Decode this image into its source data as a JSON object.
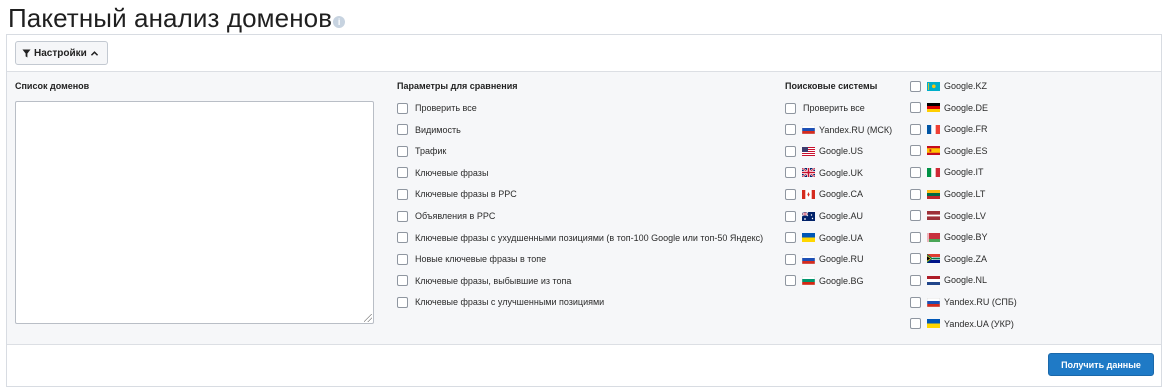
{
  "page": {
    "title": "Пакетный анализ доменов",
    "info_icon": "i"
  },
  "toolbar": {
    "settings_label": "Настройки",
    "settings_icon": "filter-icon",
    "chevron_icon": "chevron-up-icon"
  },
  "domains": {
    "title": "Список доменов",
    "value": ""
  },
  "params": {
    "title": "Параметры для сравнения",
    "items": [
      "Проверить все",
      "Видимость",
      "Трафик",
      "Ключевые фразы",
      "Ключевые фразы в PPC",
      "Объявления в PPC",
      "Ключевые фразы с ухудшенными позициями (в топ-100 Google или топ-50 Яндекс)",
      "Новые ключевые фразы в топе",
      "Ключевые фразы, выбывшие из топа",
      "Ключевые фразы с улучшенными позициями"
    ]
  },
  "engines": {
    "title": "Поисковые системы",
    "col1": [
      {
        "label": "Проверить все",
        "flag": ""
      },
      {
        "label": "Yandex.RU (МСК)",
        "flag": "ru"
      },
      {
        "label": "Google.US",
        "flag": "us"
      },
      {
        "label": "Google.UK",
        "flag": "uk"
      },
      {
        "label": "Google.CA",
        "flag": "ca"
      },
      {
        "label": "Google.AU",
        "flag": "au"
      },
      {
        "label": "Google.UA",
        "flag": "ua"
      },
      {
        "label": "Google.RU",
        "flag": "ru"
      },
      {
        "label": "Google.BG",
        "flag": "bg"
      }
    ],
    "col2": [
      {
        "label": "Google.KZ",
        "flag": "kz"
      },
      {
        "label": "Google.DE",
        "flag": "de"
      },
      {
        "label": "Google.FR",
        "flag": "fr"
      },
      {
        "label": "Google.ES",
        "flag": "es"
      },
      {
        "label": "Google.IT",
        "flag": "it"
      },
      {
        "label": "Google.LT",
        "flag": "lt"
      },
      {
        "label": "Google.LV",
        "flag": "lv"
      },
      {
        "label": "Google.BY",
        "flag": "by"
      },
      {
        "label": "Google.ZA",
        "flag": "za"
      },
      {
        "label": "Google.NL",
        "flag": "nl"
      },
      {
        "label": "Yandex.RU (СПБ)",
        "flag": "ru"
      },
      {
        "label": "Yandex.UA (УКР)",
        "flag": "ua"
      }
    ]
  },
  "footer": {
    "submit_label": "Получить данные"
  },
  "colors": {
    "accent": "#1f7ac6",
    "panel_bg": "#f6f7f9",
    "border": "#d8dce2"
  }
}
